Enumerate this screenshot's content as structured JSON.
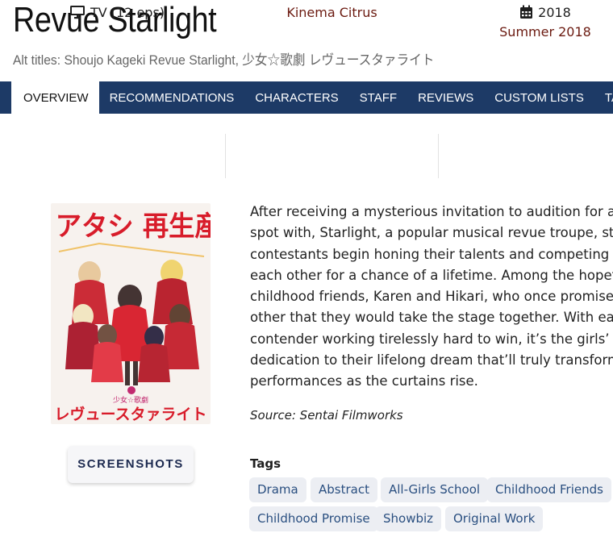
{
  "title": "Revue Starlight",
  "alt_titles": "Alt titles: Shoujo Kageki Revue Starlight, 少女☆歌劇 レヴュースタァライト",
  "tabs": [
    "Overview",
    "Recommendations",
    "Characters",
    "Staff",
    "Reviews",
    "Custom Lists",
    "Tags"
  ],
  "active_tab": "Overview",
  "info": {
    "type": "TV (12 eps)",
    "type_icon": "tv-icon",
    "studio": "Kinema Citrus",
    "year": "2018",
    "year_icon": "calendar-icon",
    "season": "Summer 2018"
  },
  "poster": {
    "top_text": "アタシ 再生産",
    "bottom_logo": "少女☆歌劇 レヴュースタァライト"
  },
  "screenshots_button": "SCREENSHOTS",
  "synopsis_lines": [
    "After receiving a mysterious invitation to audition for a c",
    "spot with, Starlight, a popular musical revue troupe, star",
    "contestants begin honing their talents and competing ag",
    "each other for a chance of a lifetime. Among the hopeful",
    "childhood friends, Karen and Hikari, who once promised",
    "other that they would take the stage together. With eac",
    "contender working tirelessly hard to win, it’s the girls’ pa",
    "dedication to their lifelong dream that’ll truly transform t",
    "performances as the curtains rise."
  ],
  "source": "Source: Sentai Filmworks",
  "tags_label": "Tags",
  "tags": [
    "Drama",
    "Abstract",
    "All-Girls School",
    "Childhood Friends",
    "Childhood Promise",
    "Showbiz",
    "Original Work"
  ],
  "colors": {
    "nav_bg": "#1d3a66",
    "link_red": "#6b1a10",
    "tag_bg": "#eceef3",
    "tag_text": "#2a4f80"
  }
}
